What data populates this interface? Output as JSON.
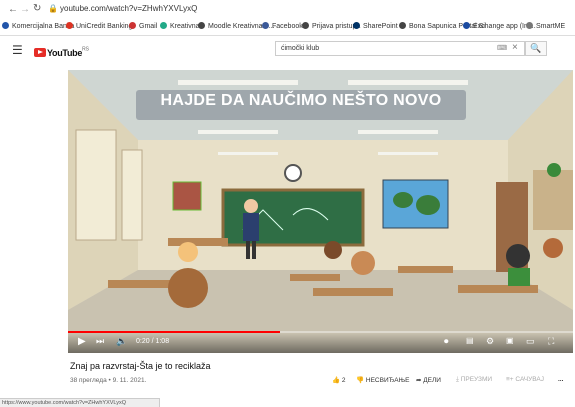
{
  "browser": {
    "url": "youtube.com/watch?v=ZHwhYXVLyxQ",
    "back_icon": "arrow-left-icon",
    "forward_icon": "arrow-right-icon",
    "reload_icon": "reload-icon"
  },
  "bookmarks": [
    {
      "label": "Komercijalna Banka",
      "color": "#2255aa"
    },
    {
      "label": "UniCredit Banking",
      "color": "#d32"
    },
    {
      "label": "Gmail",
      "color": "#c33"
    },
    {
      "label": "Kreativna",
      "color": "#2a8"
    },
    {
      "label": "Moodle Kreativna - ...",
      "color": "#444"
    },
    {
      "label": "Facebook",
      "color": "#3b5998"
    },
    {
      "label": "Prijava pristupa",
      "color": "#444"
    },
    {
      "label": "SharePoint",
      "color": "#036"
    },
    {
      "label": "Bona Sapunica Portal Si",
      "color": "#444"
    },
    {
      "label": "Exchange app (Inf...",
      "color": "#1a4aa0"
    },
    {
      "label": "SmartME",
      "color": "#777"
    }
  ],
  "youtube": {
    "logo_text": "YouTube",
    "logo_sup": "RS",
    "search_value": "ćimočki klub",
    "search_kbd": "⌨",
    "search_clear": "×",
    "search_button": "🔍"
  },
  "video": {
    "overlay_title": "HAJDE DA NAUČIMO NEŠTO NOVO",
    "timecode": "0:20 / 1:08",
    "progress_fraction": 0.42
  },
  "below": {
    "title": "Znaj pa razvrstaj-Šta je to reciklaža",
    "meta": "38 прегледа • 9. 11. 2021.",
    "likes": "2",
    "dislike_label": "НЕСВИЂАЊЕ",
    "share_label": "ДЕЛИ",
    "download_label": "ПРЕУЗМИ",
    "save_label": "САЧУВАЈ",
    "more_label": "..."
  },
  "status_bar": "https://www.youtube.com/watch?v=ZHwhYXVLyxQ",
  "colors": {
    "youtube_red": "#e52d27",
    "progress_red": "#ff0000"
  }
}
